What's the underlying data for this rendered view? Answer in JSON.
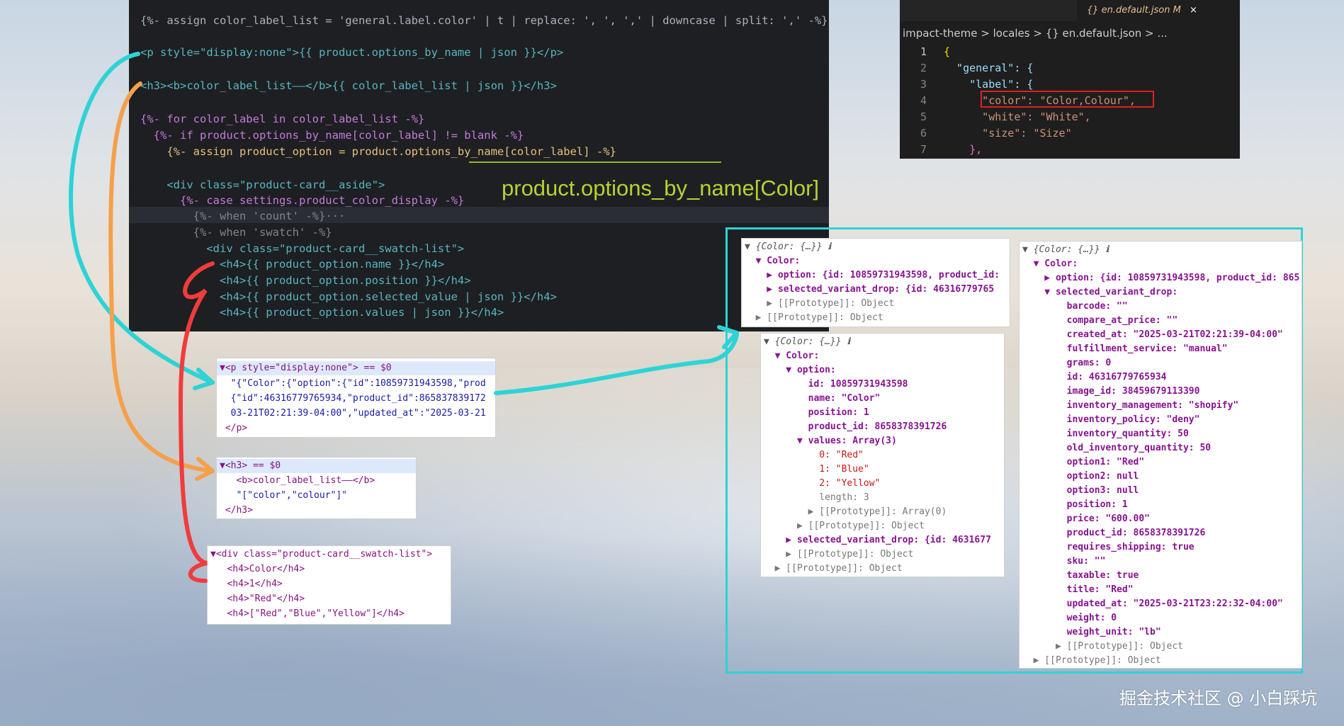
{
  "code_editor": {
    "lines": [
      "{%- assign color_label_list = 'general.label.color' | t | replace: ', ', ',' | downcase | split: ',' -%}",
      "<p style=\"display:none\">{{ product.options_by_name | json }}</p>",
      "<h3><b>color_label_list——</b>{{ color_label_list | json }}</h3>",
      "{%- for color_label in color_label_list -%}",
      "  {%- if product.options_by_name[color_label] != blank -%}",
      "    {%- assign product_option = product.options_by_name[color_label] -%}",
      "    <div class=\"product-card__aside\">",
      "      {%- case settings.product_color_display -%}",
      "        {%- when 'count' -%}···",
      "        {%- when 'swatch' -%}",
      "          <div class=\"product-card__swatch-list\">",
      "            <h4>{{ product_option.name }}</h4>",
      "            <h4>{{ product_option.position }}</h4>",
      "            <h4>{{ product_option.selected_value | json }}</h4>",
      "            <h4>{{ product_option.values | json }}</h4>"
    ],
    "annotation": "product.options_by_name[Color]"
  },
  "json_editor": {
    "tab_label": "{} en.default.json M",
    "tab_close": "×",
    "breadcrumb": "impact-theme > locales > {} en.default.json > ...",
    "line_numbers": [
      "1",
      "2",
      "3",
      "4",
      "5",
      "6",
      "7"
    ],
    "lines": [
      "{",
      "  \"general\": {",
      "    \"label\": {",
      "      \"color\": \"Color,Colour\",",
      "      \"white\": \"White\",",
      "      \"size\": \"Size\"",
      "    },"
    ]
  },
  "dom_p": {
    "lines": [
      "▼<p style=\"display:none\"> == $0",
      "  \"{\"Color\":{\"option\":{\"id\":10859731943598,\"prod",
      "  {\"id\":46316779765934,\"product_id\":865837839172",
      "  03-21T02:21:39-04:00\",\"updated_at\":\"2025-03-21",
      " </p>"
    ]
  },
  "dom_h3": {
    "lines": [
      "▼<h3> == $0",
      "   <b>color_label_list——</b>",
      "   \"[\"color\",\"colour\"]\"",
      " </h3>"
    ]
  },
  "dom_div": {
    "lines": [
      "▼<div class=\"product-card__swatch-list\">",
      "   <h4>Color</h4>",
      "   <h4>1</h4>",
      "   <h4>\"Red\"</h4>",
      "   <h4>[\"Red\",\"Blue\",\"Yellow\"]</h4>"
    ]
  },
  "console_a": {
    "lines": [
      "▼ {Color: {…}} ℹ",
      "  ▼ Color:",
      "    ▶ option: {id: 10859731943598, product_id:",
      "    ▶ selected_variant_drop: {id: 46316779765",
      "    ▶ [[Prototype]]: Object",
      "  ▶ [[Prototype]]: Object"
    ]
  },
  "console_b": {
    "lines": [
      "▼ {Color: {…}} ℹ",
      "  ▼ Color:",
      "    ▼ option:",
      "        id: 10859731943598",
      "        name: \"Color\"",
      "        position: 1",
      "        product_id: 8658378391726",
      "      ▼ values: Array(3)",
      "          0: \"Red\"",
      "          1: \"Blue\"",
      "          2: \"Yellow\"",
      "          length: 3",
      "        ▶ [[Prototype]]: Array(0)",
      "      ▶ [[Prototype]]: Object",
      "    ▶ selected_variant_drop: {id: 4631677",
      "    ▶ [[Prototype]]: Object",
      "  ▶ [[Prototype]]: Object"
    ]
  },
  "console_c": {
    "lines": [
      "▼ {Color: {…}} ℹ",
      "  ▼ Color:",
      "    ▶ option: {id: 10859731943598, product_id: 865",
      "    ▼ selected_variant_drop:",
      "        barcode: \"\"",
      "        compare_at_price: \"\"",
      "        created_at: \"2025-03-21T02:21:39-04:00\"",
      "        fulfillment_service: \"manual\"",
      "        grams: 0",
      "        id: 46316779765934",
      "        image_id: 38459679113390",
      "        inventory_management: \"shopify\"",
      "        inventory_policy: \"deny\"",
      "        inventory_quantity: 50",
      "        old_inventory_quantity: 50",
      "        option1: \"Red\"",
      "        option2: null",
      "        option3: null",
      "        position: 1",
      "        price: \"600.00\"",
      "        product_id: 8658378391726",
      "        requires_shipping: true",
      "        sku: \"\"",
      "        taxable: true",
      "        title: \"Red\"",
      "        updated_at: \"2025-03-21T23:22:32-04:00\"",
      "        weight: 0",
      "        weight_unit: \"lb\"",
      "      ▶ [[Prototype]]: Object",
      "  ▶ [[Prototype]]: Object"
    ]
  },
  "watermark": "掘金技术社区 @ 小白踩坑",
  "colors": {
    "teal_arrow": "#2dd3d6",
    "orange_arrow": "#f5a04a",
    "red_arrow": "#f03c3c",
    "red_box": "#e02020",
    "annotation_green": "#b5d334"
  }
}
